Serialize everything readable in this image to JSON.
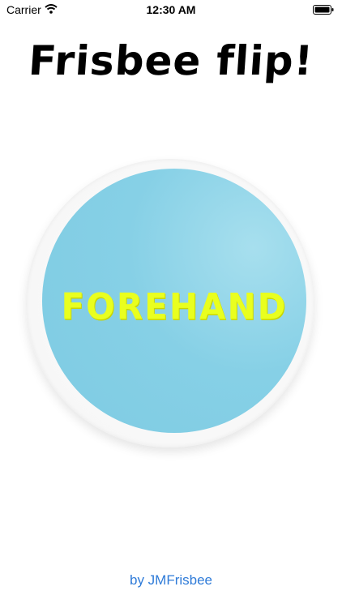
{
  "status_bar": {
    "carrier": "Carrier",
    "time": "12:30 AM",
    "wifi_icon": "wifi-icon",
    "battery_icon": "battery-icon"
  },
  "title": "Frisbee flip!",
  "frisbee": {
    "label": "FOREHAND",
    "label_color": "#e9ff1f",
    "disc_color": "#7ecbe2",
    "rim_color": "#f6f6f6"
  },
  "footer": {
    "link_text": "by JMFrisbee",
    "link_color": "#2f7bd8"
  }
}
